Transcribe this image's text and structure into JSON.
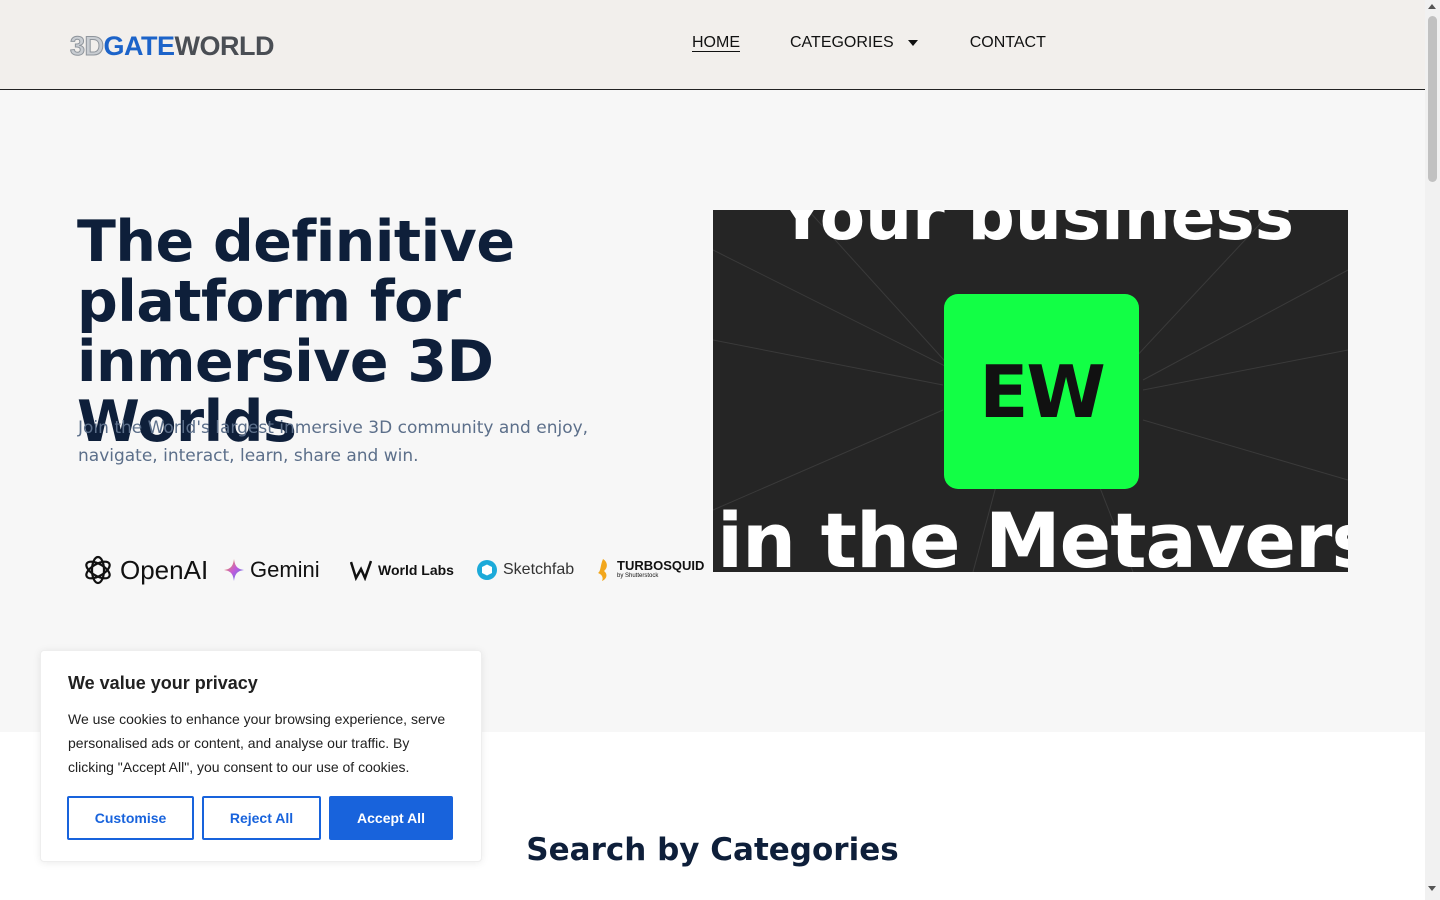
{
  "header": {
    "logo": {
      "part1": "3D",
      "part2": "GATE",
      "part3": "WORLD"
    },
    "nav": {
      "home": "HOME",
      "categories": "CATEGORIES",
      "contact": "CONTACT"
    }
  },
  "hero": {
    "title": "The definitive platform for inmersive 3D Worlds",
    "subtitle": "Join the World's largest inmersive 3D community and enjoy, navigate, interact, learn, share and win.",
    "partners": [
      "OpenAI",
      "Gemini",
      "World Labs",
      "Sketchfab",
      "TURBOSQUID"
    ],
    "partner_sub": "by Shutterstock",
    "video": {
      "top_text": "Your business",
      "badge": "EW",
      "bottom_text": "in the Metaverse",
      "badge_color": "#12ff45"
    }
  },
  "categories": {
    "title": "Search by Categories"
  },
  "cookie": {
    "title": "We value your privacy",
    "body": "We use cookies to enhance your browsing experience, serve personalised ads or content, and analyse our traffic. By clicking \"Accept All\", you consent to our use of cookies.",
    "customise": "Customise",
    "reject": "Reject All",
    "accept": "Accept All",
    "accent": "#1863dc"
  }
}
